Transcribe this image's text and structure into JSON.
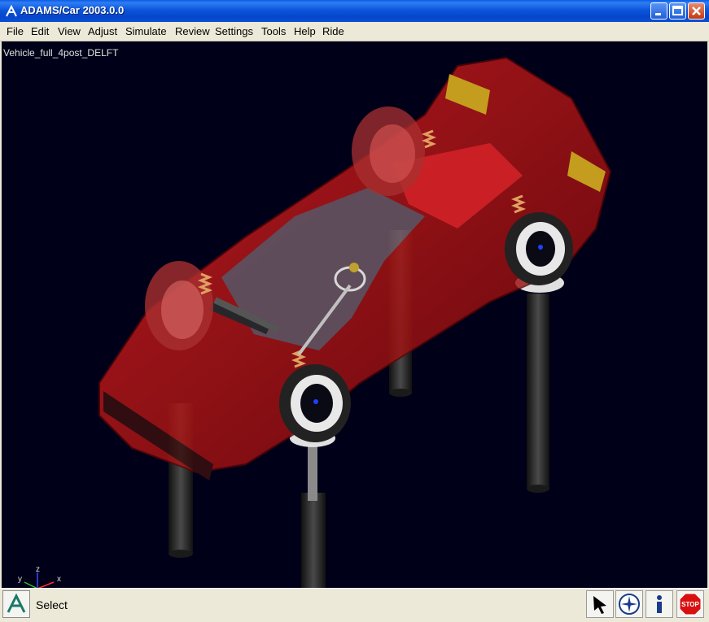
{
  "window": {
    "title": "ADAMS/Car 2003.0.0",
    "controls": [
      "minimize",
      "maximize",
      "close"
    ]
  },
  "menu": [
    "File",
    "Edit",
    "View",
    "Adjust",
    "Simulate",
    "Review",
    "Settings",
    "Tools",
    "Help",
    "Ride"
  ],
  "viewport": {
    "model_name": "Vehicle_full_4post_DELFT",
    "background": "#000018",
    "axis_labels": {
      "y": "y",
      "z": "z",
      "x": "x"
    }
  },
  "status": {
    "text": "Select",
    "tools": [
      "select-arrow-icon",
      "compass-icon",
      "info-icon",
      "stop-icon"
    ],
    "stop_label": "STOP"
  },
  "colors": {
    "titlebar": "#0a4fd6",
    "body_red": "#c81414",
    "posts": "#2a2a2a"
  }
}
